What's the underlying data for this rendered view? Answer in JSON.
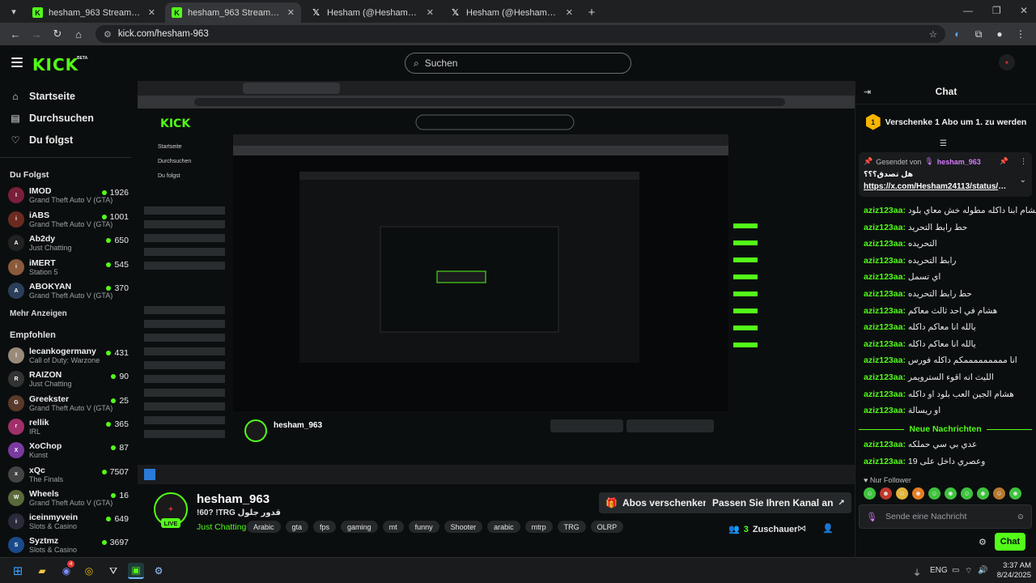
{
  "browser": {
    "tabs": [
      {
        "title": "hesham_963 Stream - Watch Live",
        "icon": "kick",
        "active": false
      },
      {
        "title": "hesham_963 Stream - Watch Live",
        "icon": "kick",
        "active": true
      },
      {
        "title": "Hesham (@Hesham24113) / X",
        "icon": "x",
        "active": false
      },
      {
        "title": "Hesham (@Hesham24113) / X",
        "icon": "x",
        "active": false
      }
    ],
    "url": "kick.com/hesham-963"
  },
  "header": {
    "logo": "KICK",
    "logo_badge": "BETA",
    "search_placeholder": "Suchen"
  },
  "sidebar": {
    "nav": [
      {
        "label": "Startseite",
        "icon": "home-icon"
      },
      {
        "label": "Durchsuchen",
        "icon": "browse-icon"
      },
      {
        "label": "Du folgst",
        "icon": "heart-icon"
      }
    ],
    "following_heading": "Du Folgst",
    "following": [
      {
        "name": "IMOD",
        "game": "Grand Theft Auto V (GTA)",
        "viewers": "1926",
        "color": "#7a1f3a"
      },
      {
        "name": "iABS",
        "game": "Grand Theft Auto V (GTA)",
        "viewers": "1001",
        "color": "#6b2a20"
      },
      {
        "name": "Ab2dy",
        "game": "Just Chatting",
        "viewers": "650",
        "color": "#222"
      },
      {
        "name": "iMERT",
        "game": "Station 5",
        "viewers": "545",
        "color": "#8a5a3a"
      },
      {
        "name": "ABOKYAN",
        "game": "Grand Theft Auto V (GTA)",
        "viewers": "370",
        "color": "#2b3f5a"
      }
    ],
    "more_link": "Mehr Anzeigen",
    "recommended_heading": "Empfohlen",
    "recommended": [
      {
        "name": "lecankogermany",
        "game": "Call of Duty: Warzone",
        "viewers": "431",
        "color": "#9a8a7a"
      },
      {
        "name": "RAIZON",
        "game": "Just Chatting",
        "viewers": "90",
        "color": "#333"
      },
      {
        "name": "Greekster",
        "game": "Grand Theft Auto V (GTA)",
        "viewers": "25",
        "color": "#5a3a2a"
      },
      {
        "name": "rellik",
        "game": "IRL",
        "viewers": "365",
        "color": "#a0306a"
      },
      {
        "name": "XoChop",
        "game": "Kunst",
        "viewers": "87",
        "color": "#7a3aa0"
      },
      {
        "name": "xQc",
        "game": "The Finals",
        "viewers": "7507",
        "color": "#444"
      },
      {
        "name": "Wheels",
        "game": "Grand Theft Auto V (GTA)",
        "viewers": "16",
        "color": "#5a6a3a"
      },
      {
        "name": "iceinmyvein",
        "game": "Slots & Casino",
        "viewers": "649",
        "color": "#2a2a3a"
      },
      {
        "name": "Syztmz",
        "game": "Slots & Casino",
        "viewers": "3697",
        "color": "#1a4a8a"
      }
    ]
  },
  "stream": {
    "channel": "hesham_963",
    "title": "!60? !TRG قدور جلول",
    "category": "Just Chatting",
    "live_badge": "LIVE",
    "tags": [
      "Arabic",
      "gta",
      "fps",
      "gaming",
      "mt",
      "funny",
      "Shooter",
      "arabic",
      "mtrp",
      "TRG",
      "OLRP"
    ],
    "gift_button": "Abos verschenken",
    "customize_button": "Passen Sie Ihren Kanal an",
    "viewers": "3",
    "viewers_label": "Zuschauer"
  },
  "chat": {
    "title": "Chat",
    "gift_prompt": "Verschenke 1 Abo um 1. zu werden",
    "gift_rank": "1",
    "pinned": {
      "by_label": "Gesendet von",
      "by_user": "hesham_963",
      "message": "هل تصدق؟؟؟",
      "link": "https://x.com/Hesham24113/status/19..."
    },
    "messages": [
      {
        "user": "aziz123aa:",
        "text": "هشام ابنا داكله مطوله خش معاي بلود"
      },
      {
        "user": "aziz123aa:",
        "text": "حط رابط التحريد"
      },
      {
        "user": "aziz123aa:",
        "text": "التحريده"
      },
      {
        "user": "aziz123aa:",
        "text": "رابط التحريده"
      },
      {
        "user": "aziz123aa:",
        "text": "اي تسمل"
      },
      {
        "user": "aziz123aa:",
        "text": "حط رابط التحريده"
      },
      {
        "user": "aziz123aa:",
        "text": "هشام في احد ثالث معاكم"
      },
      {
        "user": "aziz123aa:",
        "text": "يالله انا معاكم داكله"
      },
      {
        "user": "aziz123aa:",
        "text": "يالله انا معاكم داكله"
      },
      {
        "user": "aziz123aa:",
        "text": "انا مممممممممكم داكله فورس"
      },
      {
        "user": "aziz123aa:",
        "text": "الليث انه اقوء السترويمر"
      },
      {
        "user": "aziz123aa:",
        "text": "هشام الجين العب بلود او داكله"
      },
      {
        "user": "aziz123aa:",
        "text": "او ريسالة"
      }
    ],
    "new_messages_label": "Neue Nachrichten",
    "new_messages": [
      {
        "user": "aziz123aa:",
        "text": "عدي بي سي حملكه"
      },
      {
        "user": "aziz123aa:",
        "text": "وعصري داخل على 19"
      }
    ],
    "follower_mode": "Nur Follower",
    "input_placeholder": "Sende eine Nachricht",
    "send_button": "Chat"
  },
  "taskbar": {
    "language": "ENG",
    "time": "3:37 AM",
    "date": "8/24/2025",
    "discord_badge": "4"
  },
  "colors": {
    "kick_green": "#53fc18",
    "background": "#0b0e0f",
    "panel": "#191b1d"
  }
}
